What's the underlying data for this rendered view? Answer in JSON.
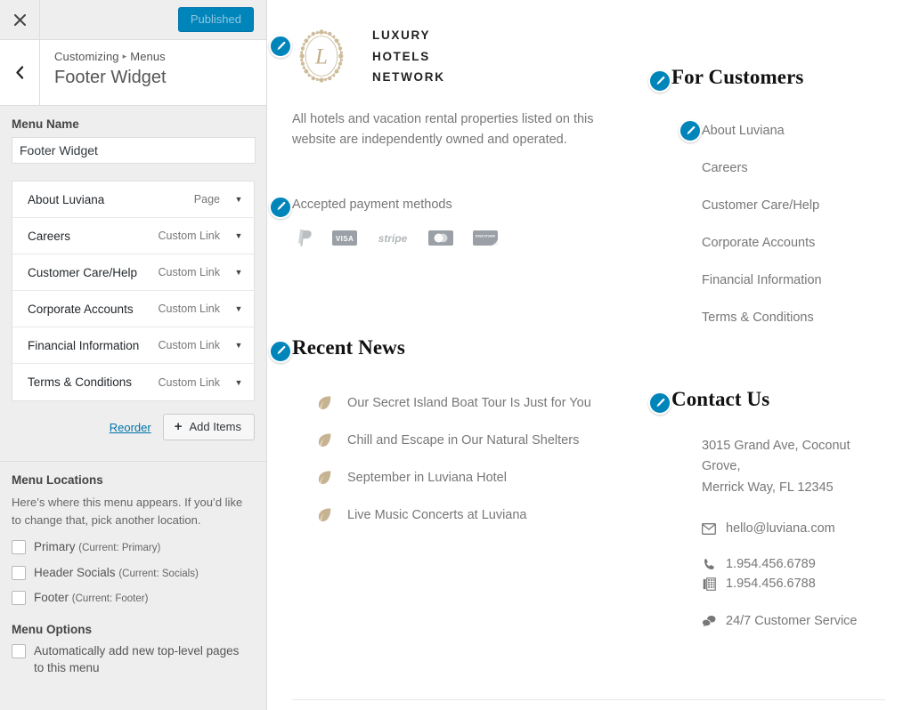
{
  "customizer": {
    "close_icon": "close-icon",
    "publish_label": "Published",
    "back_icon": "chevron-left-icon",
    "breadcrumb_root": "Customizing",
    "breadcrumb_sep": "▸",
    "breadcrumb_current": "Menus",
    "panel_title": "Footer Widget",
    "menu_name_label": "Menu Name",
    "menu_name_value": "Footer Widget",
    "menu_items": [
      {
        "name": "About Luviana",
        "type": "Page",
        "caret": "▼"
      },
      {
        "name": "Careers",
        "type": "Custom Link",
        "caret": "▼"
      },
      {
        "name": "Customer Care/Help",
        "type": "Custom Link",
        "caret": "▼"
      },
      {
        "name": "Corporate Accounts",
        "type": "Custom Link",
        "caret": "▼"
      },
      {
        "name": "Financial Information",
        "type": "Custom Link",
        "caret": "▼"
      },
      {
        "name": "Terms & Conditions",
        "type": "Custom Link",
        "caret": "▼"
      }
    ],
    "reorder_label": "Reorder",
    "add_items_label": "Add Items",
    "add_items_icon": "plus-icon",
    "locations_heading": "Menu Locations",
    "locations_desc": "Here’s where this menu appears. If you’d like to change that, pick another location.",
    "locations": [
      {
        "label": "Primary",
        "current": "(Current: Primary)",
        "checked": false
      },
      {
        "label": "Header Socials",
        "current": "(Current: Socials)",
        "checked": false
      },
      {
        "label": "Footer",
        "current": "(Current: Footer)",
        "checked": false
      }
    ],
    "options_heading": "Menu Options",
    "auto_add_label": "Automatically add new top-level pages to this menu",
    "auto_add_checked": false
  },
  "preview": {
    "edit_icon": "pencil-edit-icon",
    "brand": {
      "logo_icon": "luxury-hotels-wreath-logo",
      "line1": "LUXURY",
      "line2": "HOTELS",
      "line3": "NETWORK",
      "disclaimer": "All hotels and vacation rental properties listed on this website are independently owned and operated."
    },
    "payments": {
      "title": "Accepted payment methods",
      "methods": [
        {
          "name": "paypal-icon",
          "label": ""
        },
        {
          "name": "visa-icon",
          "label": "VISA"
        },
        {
          "name": "stripe-icon",
          "label": "stripe"
        },
        {
          "name": "mastercard-icon",
          "label": ""
        },
        {
          "name": "discover-icon",
          "label": "DISCOVER"
        }
      ]
    },
    "for_customers": {
      "heading": "For Customers",
      "links": [
        "About Luviana",
        "Careers",
        "Customer Care/Help",
        "Corporate Accounts",
        "Financial Information",
        "Terms & Conditions"
      ]
    },
    "recent_news": {
      "heading": "Recent News",
      "bullet_icon": "leaf-icon",
      "items": [
        "Our Secret Island Boat Tour Is Just for You",
        "Chill and Escape in Our Natural Shelters",
        "September in Luviana Hotel",
        "Live Music Concerts at Luviana"
      ]
    },
    "contact": {
      "heading": "Contact Us",
      "address_line1": "3015 Grand Ave, Coconut Grove,",
      "address_line2": "Merrick Way, FL 12345",
      "email_icon": "envelope-icon",
      "email": "hello@luviana.com",
      "phone_icon": "phone-icon",
      "phone": "1.954.456.6789",
      "fax_icon": "fax-icon",
      "fax": "1.954.456.6788",
      "service_icon": "chat-bubbles-icon",
      "service": "24/7 Customer Service"
    }
  },
  "colors": {
    "accent_blue": "#0085ba",
    "panel_bg": "#eeeeee",
    "text_grey": "#777777",
    "gold": "#c2ae8a"
  }
}
